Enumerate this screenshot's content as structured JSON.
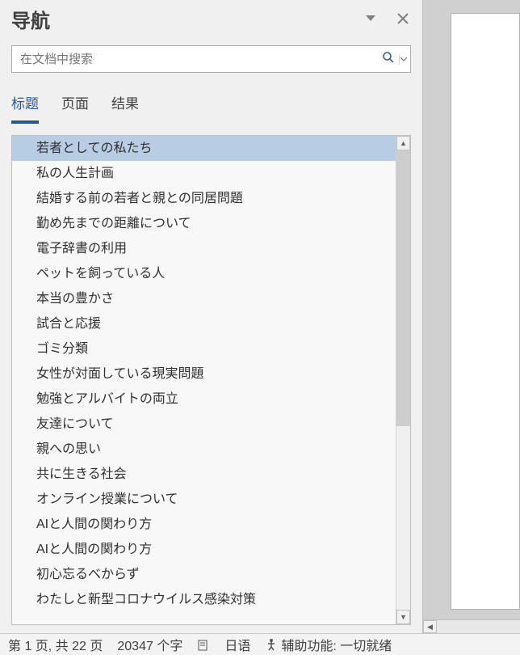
{
  "nav": {
    "title": "导航",
    "search_placeholder": "在文档中搜索"
  },
  "tabs": [
    {
      "label": "标题",
      "active": true
    },
    {
      "label": "页面",
      "active": false
    },
    {
      "label": "结果",
      "active": false
    }
  ],
  "headings": [
    {
      "label": "若者としての私たち",
      "selected": true
    },
    {
      "label": "私の人生計画",
      "selected": false
    },
    {
      "label": "結婚する前の若者と親との同居問題",
      "selected": false
    },
    {
      "label": "勤め先までの距離について",
      "selected": false
    },
    {
      "label": "電子辞書の利用",
      "selected": false
    },
    {
      "label": "ペットを飼っている人",
      "selected": false
    },
    {
      "label": "本当の豊かさ",
      "selected": false
    },
    {
      "label": "試合と応援",
      "selected": false
    },
    {
      "label": "ゴミ分類",
      "selected": false
    },
    {
      "label": "女性が対面している現実問題",
      "selected": false
    },
    {
      "label": "勉強とアルバイトの両立",
      "selected": false
    },
    {
      "label": "友達について",
      "selected": false
    },
    {
      "label": "親への思い",
      "selected": false
    },
    {
      "label": "共に生きる社会",
      "selected": false
    },
    {
      "label": "オンライン授業について",
      "selected": false
    },
    {
      "label": "AIと人間の関わり方",
      "selected": false
    },
    {
      "label": "AIと人間の関わり方",
      "selected": false
    },
    {
      "label": "初心忘るべからず",
      "selected": false
    },
    {
      "label": "わたしと新型コロナウイルス感染対策",
      "selected": false
    }
  ],
  "status": {
    "page_info": "第 1 页, 共 22 页",
    "word_count": "20347 个字",
    "language": "日语",
    "accessibility": "辅助功能: 一切就绪"
  }
}
